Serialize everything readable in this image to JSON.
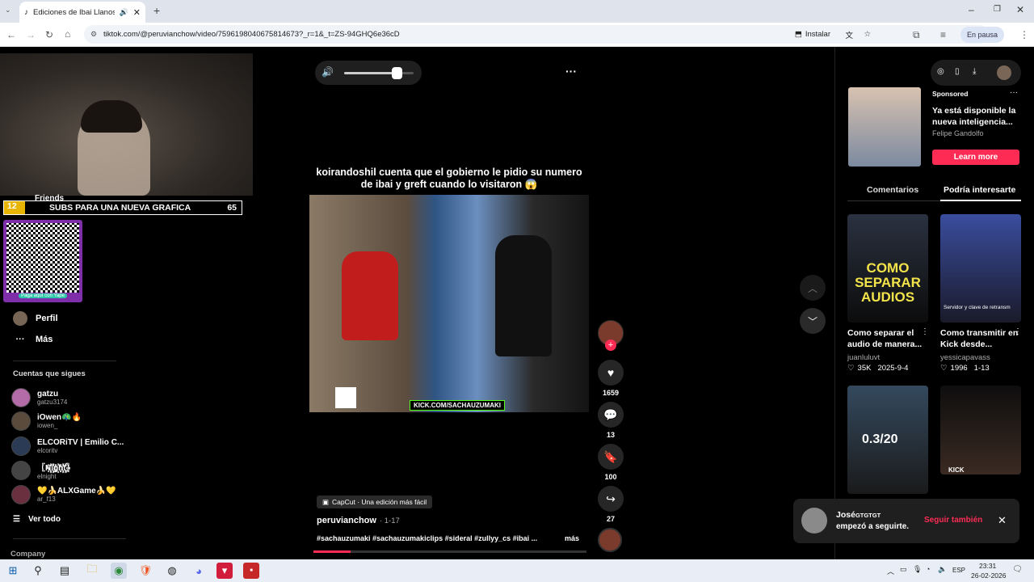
{
  "browser": {
    "tab_title": "Ediciones de Ibai Llanos y P",
    "url": "tiktok.com/@peruvianchow/video/7596198040675814673?_r=1&_t=ZS-94GHQ6e36cD",
    "install_label": "Instalar",
    "pause_label": "En pausa"
  },
  "overlay": {
    "banner_count": "12",
    "banner_text": "SUBS PARA UNA NUEVA GRAFICA",
    "banner_right": "65",
    "qr_caption": "Paga aquí con Yape",
    "friends_label": "Friends"
  },
  "sidebar": {
    "nav": [
      {
        "label": "Perfil"
      },
      {
        "label": "Más"
      }
    ],
    "following_title": "Cuentas que sigues",
    "accounts": [
      {
        "name": "gatzu",
        "handle": "gatzu3174"
      },
      {
        "name": "iOwen🦚🔥",
        "handle": "iowen_"
      },
      {
        "name": "ELCORiTV | Emilio C...",
        "handle": "elcoritv"
      },
      {
        "name": "〖N꙰i꙰g꙰h꙰t꙰〗",
        "handle": "elnight"
      },
      {
        "name": "💛🍌ALXGame🍌💛",
        "handle": "ar_f13"
      }
    ],
    "see_all": "Ver todo",
    "company": "Company"
  },
  "video": {
    "caption": "koirandoshil cuenta que el gobierno le pidio su numero de ibai y greft cuando lo visitaron 😱",
    "watermark": "KICK.COM/SACHAUZUMAKI",
    "capcut": "CapCut · Una edición más fácil",
    "author": "peruvianchow",
    "date": "· 1-17",
    "hashtags": "#sachauzumaki #sachauzumakiclips #sideral #zullyy_cs #ibai ...",
    "more": "más",
    "volume_level": 0.75,
    "likes": "1659",
    "comments": "13",
    "saves": "100",
    "shares": "27"
  },
  "ad": {
    "sponsored": "Sponsored",
    "title": "Ya está disponible la nueva inteligencia...",
    "author": "Felipe Gandolfo",
    "cta": "Learn more"
  },
  "tabs": {
    "comments": "Comentarios",
    "interest": "Podría interesarte"
  },
  "recommendations": [
    {
      "title": "Como separar el audio de manera...",
      "author": "juanluluvt",
      "likes": "35K",
      "date": "2025-9-4",
      "thumb_text": "COMO SEPARAR AUDIOS"
    },
    {
      "title": "Como transmitir en Kick desde...",
      "author": "yessicapavass",
      "likes": "1996",
      "date": "1-13",
      "thumb_text": "Servidor y clave de retransm"
    },
    {
      "title": "",
      "author": "",
      "likes": "",
      "date": "",
      "thumb_text": "0.3/20"
    },
    {
      "title": "",
      "author": "",
      "likes": "",
      "date": "",
      "thumb_text": "KICK"
    }
  ],
  "notification": {
    "user": "José",
    "user_suffix": "GTGTGT",
    "text": "empezó a seguirte.",
    "action": "Seguir también"
  },
  "taskbar": {
    "time": "23:31",
    "date": "26-02-2026",
    "lang": "ESP"
  }
}
